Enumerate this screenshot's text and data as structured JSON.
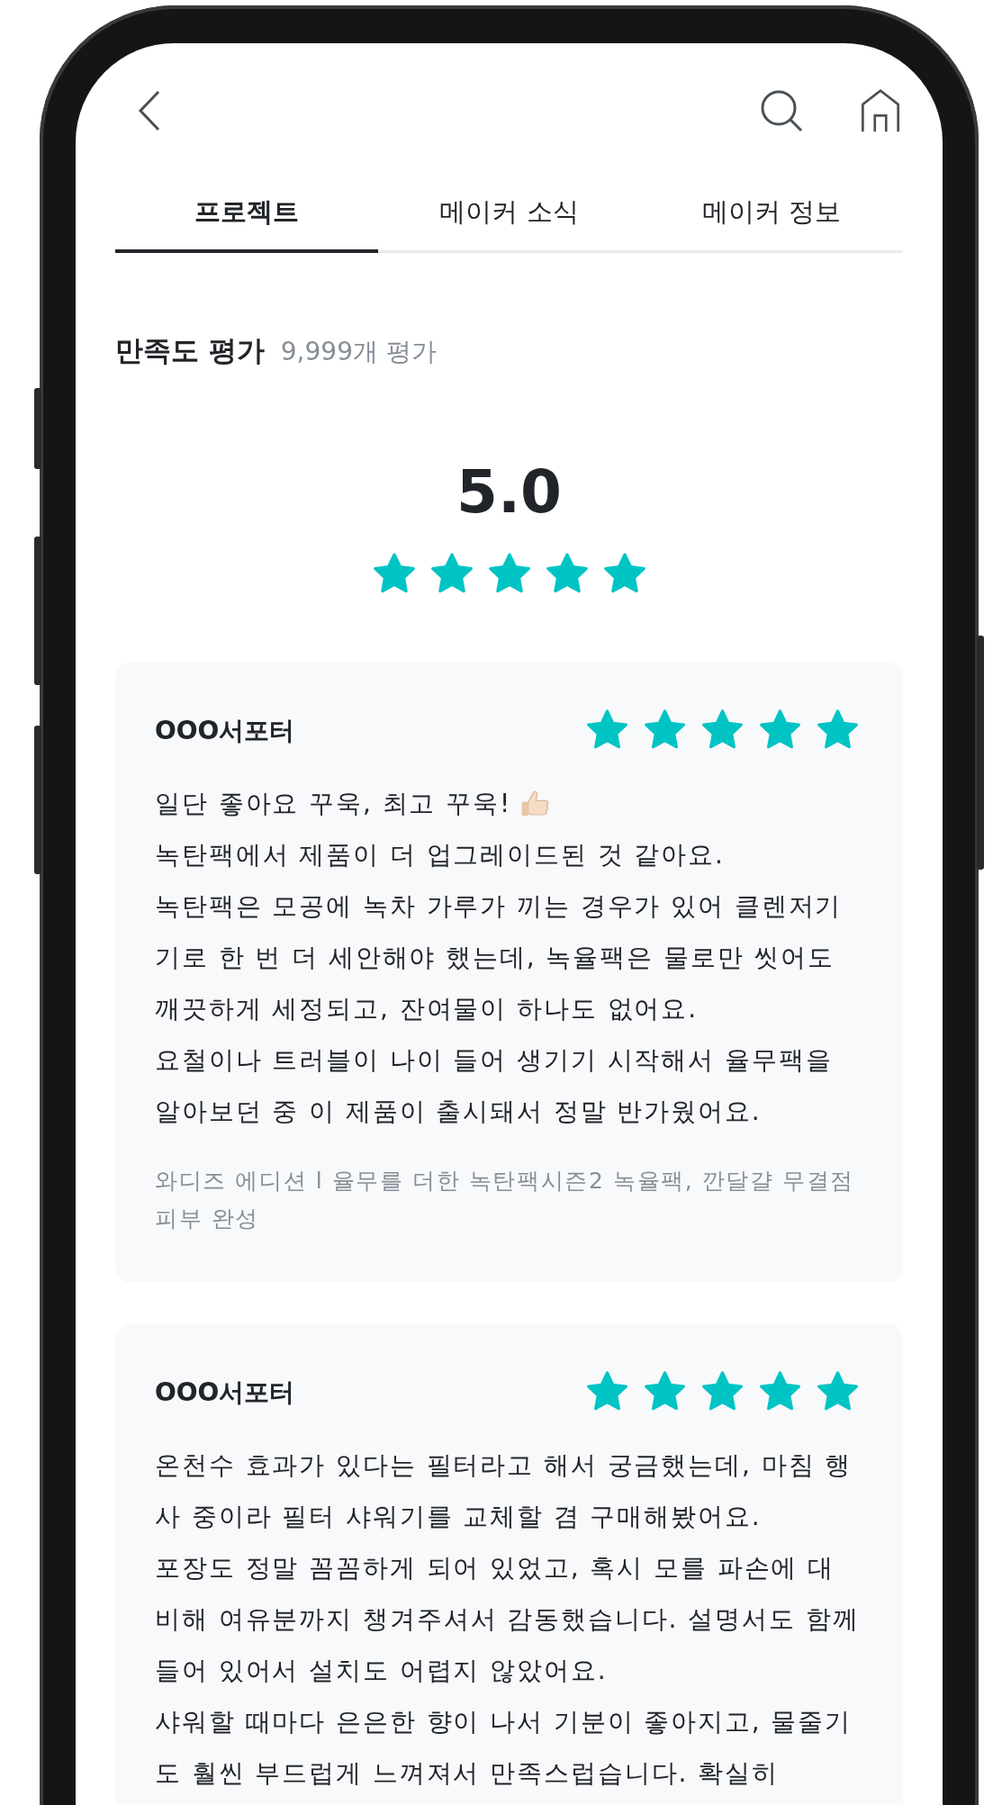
{
  "tabs": [
    {
      "label": "프로젝트",
      "selected": true
    },
    {
      "label": "메이커 소식",
      "selected": false
    },
    {
      "label": "메이커 정보",
      "selected": false
    }
  ],
  "rating_summary": {
    "title": "만족도 평가",
    "count": "9,999개 평가",
    "score": "5.0",
    "stars": 5
  },
  "reviews": [
    {
      "author": "OOO서포터",
      "stars": 5,
      "paragraphs": [
        {
          "kind": "icon",
          "text": "일단 좋아요 꾸욱, 최고 꾸욱!"
        },
        {
          "kind": "plain",
          "text": "녹탄팩에서 제품이 더 업그레이드된 것 같아요."
        },
        {
          "kind": "plain",
          "text": "녹탄팩은 모공에 녹차 가루가 끼는 경우가 있어 클렌저기기로 한 번 더 세안해야 했는데, 녹율팩은 물로만 씻어도 깨끗하게 세정되고, 잔여물이 하나도 없어요."
        },
        {
          "kind": "plain",
          "text": "요철이나 트러블이 나이 들어 생기기 시작해서 율무팩을 알아보던 중 이 제품이 출시돼서 정말 반가웠어요."
        }
      ],
      "product": "와디즈 에디션 l 율무를 더한 녹탄팩시즌2 녹율팩, 깐달걀 무결점 피부 완성"
    },
    {
      "author": "OOO서포터",
      "stars": 5,
      "paragraphs": [
        {
          "kind": "plain",
          "text": "온천수 효과가 있다는 필터라고 해서 궁금했는데, 마침 행사 중이라 필터 샤워기를 교체할 겸 구매해봤어요."
        },
        {
          "kind": "plain",
          "text": "포장도 정말 꼼꼼하게 되어 있었고, 혹시 모를 파손에 대비해 여유분까지 챙겨주셔서 감동했습니다. 설명서도 함께 들어 있어서 설치도 어렵지 않았어요."
        },
        {
          "kind": "plain",
          "text": "샤워할 때마다 은은한 향이 나서 기분이 좋아지고, 물줄기도 훨씬 부드럽게 느껴져서 만족스럽습니다. 확실히"
        }
      ]
    }
  ]
}
